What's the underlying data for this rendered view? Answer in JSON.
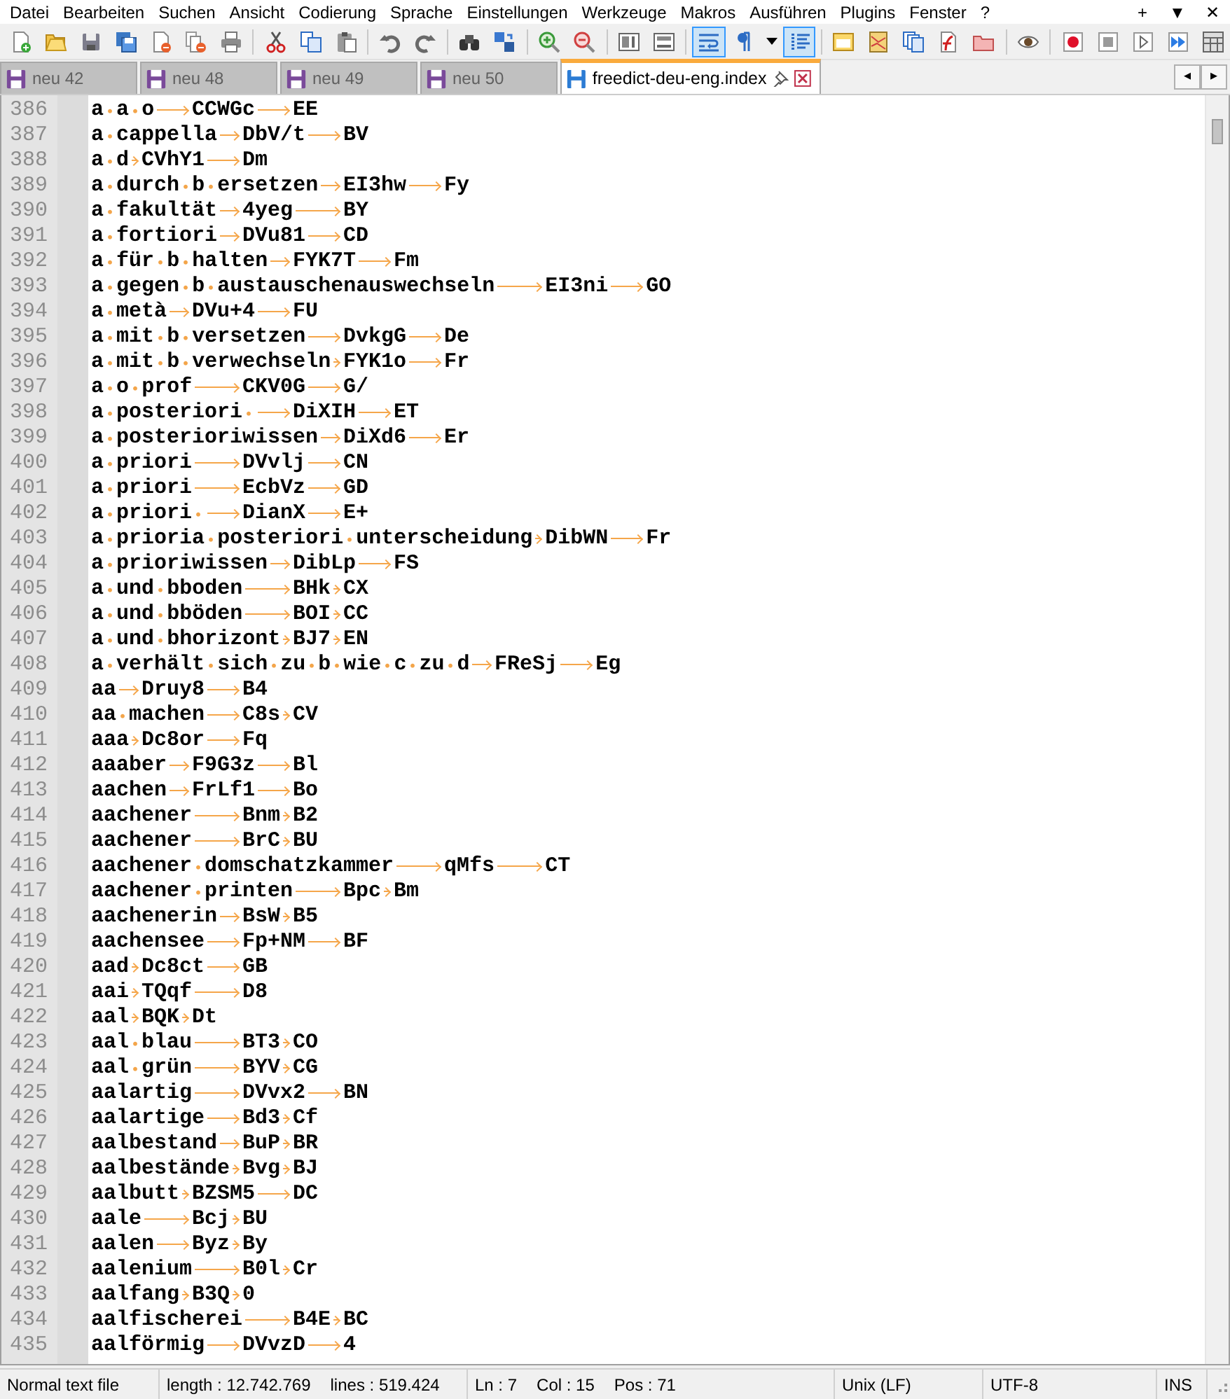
{
  "menu": [
    "Datei",
    "Bearbeiten",
    "Suchen",
    "Ansicht",
    "Codierung",
    "Sprache",
    "Einstellungen",
    "Werkzeuge",
    "Makros",
    "Ausführen",
    "Plugins",
    "Fenster",
    "?"
  ],
  "window_controls": [
    "+",
    "▼",
    "✕"
  ],
  "toolbar": [
    {
      "kind": "new"
    },
    {
      "kind": "open"
    },
    {
      "kind": "save"
    },
    {
      "kind": "saveall"
    },
    {
      "kind": "close"
    },
    {
      "kind": "closeall"
    },
    {
      "kind": "print"
    },
    {
      "kind": "separator"
    },
    {
      "kind": "cut"
    },
    {
      "kind": "copy"
    },
    {
      "kind": "paste"
    },
    {
      "kind": "separator"
    },
    {
      "kind": "undo"
    },
    {
      "kind": "redo"
    },
    {
      "kind": "separator"
    },
    {
      "kind": "find"
    },
    {
      "kind": "replace"
    },
    {
      "kind": "separator"
    },
    {
      "kind": "zoomin"
    },
    {
      "kind": "zoomout"
    },
    {
      "kind": "separator"
    },
    {
      "kind": "syncv"
    },
    {
      "kind": "synch"
    },
    {
      "kind": "separator"
    },
    {
      "kind": "wrap",
      "pressed": true
    },
    {
      "kind": "showall",
      "pressed": false
    },
    {
      "kind": "caret"
    },
    {
      "kind": "indent",
      "pressed": true
    },
    {
      "kind": "separator"
    },
    {
      "kind": "udl"
    },
    {
      "kind": "docmap"
    },
    {
      "kind": "doclist"
    },
    {
      "kind": "funclist"
    },
    {
      "kind": "folder"
    },
    {
      "kind": "separator"
    },
    {
      "kind": "monitor"
    },
    {
      "kind": "separator"
    },
    {
      "kind": "record"
    },
    {
      "kind": "stop"
    },
    {
      "kind": "play"
    },
    {
      "kind": "playmulti"
    },
    {
      "kind": "savemacro"
    }
  ],
  "tabs": [
    {
      "label": "neu 42",
      "selected": false
    },
    {
      "label": "neu 48",
      "selected": false
    },
    {
      "label": "neu 49",
      "selected": false
    },
    {
      "label": "neu 50",
      "selected": false
    },
    {
      "label": "freedict-deu-eng.index",
      "selected": true
    }
  ],
  "tab_scroll": [
    "◂",
    "▸"
  ],
  "editor": {
    "lines": [
      {
        "number": "386",
        "text": "a a o\tCCWGc\tEE"
      },
      {
        "number": "387",
        "text": "a cappella\tDbV/t\tBV"
      },
      {
        "number": "388",
        "text": "a d\tCVhY1\tDm"
      },
      {
        "number": "389",
        "text": "a durch b ersetzen\tEI3hw\tFy"
      },
      {
        "number": "390",
        "text": "a fakultät\t4yeg\tBY"
      },
      {
        "number": "391",
        "text": "a fortiori\tDVu81\tCD"
      },
      {
        "number": "392",
        "text": "a für b halten\tFYK7T\tFm"
      },
      {
        "number": "393",
        "text": "a gegen b austauschenauswechseln\tEI3ni\tGO"
      },
      {
        "number": "394",
        "text": "a metà\tDVu+4\tFU"
      },
      {
        "number": "395",
        "text": "a mit b versetzen\tDvkgG\tDe"
      },
      {
        "number": "396",
        "text": "a mit b verwechseln\tFYK1o\tFr"
      },
      {
        "number": "397",
        "text": "a o prof\tCKV0G\tG/"
      },
      {
        "number": "398",
        "text": "a posteriori \tDiXIH\tET"
      },
      {
        "number": "399",
        "text": "a posterioriwissen\tDiXd6\tEr"
      },
      {
        "number": "400",
        "text": "a priori\tDVvlj\tCN"
      },
      {
        "number": "401",
        "text": "a priori\tEcbVz\tGD"
      },
      {
        "number": "402",
        "text": "a priori \tDianX\tE+"
      },
      {
        "number": "403",
        "text": "a prioria posteriori unterscheidung\tDibWN\tFr"
      },
      {
        "number": "404",
        "text": "a prioriwissen\tDibLp\tFS"
      },
      {
        "number": "405",
        "text": "a und bboden\tBHk\tCX"
      },
      {
        "number": "406",
        "text": "a und bböden\tBOI\tCC"
      },
      {
        "number": "407",
        "text": "a und bhorizont\tBJ7\tEN"
      },
      {
        "number": "408",
        "text": "a verhält sich zu b wie c zu d\tFReSj\tEg"
      },
      {
        "number": "409",
        "text": "aa\tDruy8\tB4"
      },
      {
        "number": "410",
        "text": "aa machen\tC8s\tCV"
      },
      {
        "number": "411",
        "text": "aaa\tDc8or\tFq"
      },
      {
        "number": "412",
        "text": "aaaber\tF9G3z\tBl"
      },
      {
        "number": "413",
        "text": "aachen\tFrLf1\tBo"
      },
      {
        "number": "414",
        "text": "aachener\tBnm\tB2"
      },
      {
        "number": "415",
        "text": "aachener\tBrC\tBU"
      },
      {
        "number": "416",
        "text": "aachener domschatzkammer\tqMfs\tCT"
      },
      {
        "number": "417",
        "text": "aachener printen\tBpc\tBm"
      },
      {
        "number": "418",
        "text": "aachenerin\tBsW\tB5"
      },
      {
        "number": "419",
        "text": "aachensee\tFp+NM\tBF"
      },
      {
        "number": "420",
        "text": "aad\tDc8ct\tGB"
      },
      {
        "number": "421",
        "text": "aai\tTQqf\tD8"
      },
      {
        "number": "422",
        "text": "aal\tBQK\tDt"
      },
      {
        "number": "423",
        "text": "aal blau\tBT3\tCO"
      },
      {
        "number": "424",
        "text": "aal grün\tBYV\tCG"
      },
      {
        "number": "425",
        "text": "aalartig\tDVvx2\tBN"
      },
      {
        "number": "426",
        "text": "aalartige\tBd3\tCf"
      },
      {
        "number": "427",
        "text": "aalbestand\tBuP\tBR"
      },
      {
        "number": "428",
        "text": "aalbestände\tBvg\tBJ"
      },
      {
        "number": "429",
        "text": "aalbutt\tBZSM5\tDC"
      },
      {
        "number": "430",
        "text": "aale\tBcj\tBU"
      },
      {
        "number": "431",
        "text": "aalen\tByz\tBy"
      },
      {
        "number": "432",
        "text": "aalenium\tB0l\tCr"
      },
      {
        "number": "433",
        "text": "aalfang\tB3Q\t0"
      },
      {
        "number": "434",
        "text": "aalfischerei\tB4E\tBC"
      },
      {
        "number": "435",
        "text": "aalförmig\tDVvzD\t4"
      }
    ]
  },
  "status_bar": {
    "file_type": "Normal text file",
    "length": "length : 12.742.769",
    "lines": "lines : 519.424",
    "ln": "Ln : 7",
    "col": "Col : 15",
    "pos": "Pos : 71",
    "eol": "Unix (LF)",
    "encoding": "UTF-8",
    "mode": "INS"
  }
}
